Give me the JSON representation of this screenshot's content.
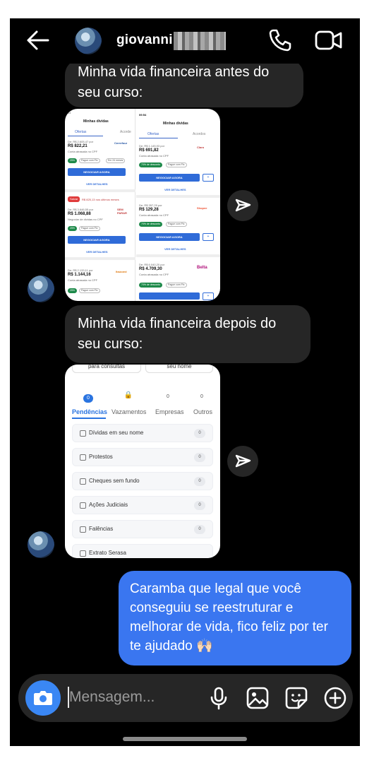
{
  "header": {
    "username": "giovanni"
  },
  "messages": [
    {
      "id": "m1",
      "from": "them",
      "text": "Minha vida financeira antes do seu curso:"
    },
    {
      "id": "m2",
      "from": "them",
      "text": "Minha vida financeira depois do seu curso:"
    },
    {
      "id": "m3",
      "from": "me",
      "text": "Caramba que legal que você conseguiu se reestruturar e melhorar de vida, fico feliz por ter te ajudado 🙌🏻"
    }
  ],
  "screenshot_before": {
    "left": {
      "status_time": "64",
      "title": "Minhas dívidas",
      "tabs": [
        "Ofertas",
        "Acorde"
      ],
      "items": [
        {
          "from": "De: R$ 2.605,47 por",
          "value": "R$ 822,21",
          "sub": "Conta atrasada no CPF",
          "brand": "Cerrefour",
          "button": "NEGOCIAR AGORA",
          "link": "VER DETALHES"
        },
        {
          "from": "De: R$ 3.646,55 por",
          "value": "R$ 1.068,88",
          "sub": "Negociar de dividas no CPF",
          "brand": "SEM PARAR",
          "button": "NEGOCIAR AGORA",
          "link": "VER DETALHES",
          "badge": "Salvar",
          "badge_note": "R$ 825,13 nos ultimos meses"
        },
        {
          "from": "De: R$ 2.133,11 por",
          "value": "R$ 1.144,16",
          "sub": "Conta atrasada no CPF",
          "brand": "Itaúcard"
        }
      ],
      "chips": [
        "25%",
        "Pague com Pix",
        "Em 24 meses"
      ]
    },
    "right": {
      "status_time": "09:54",
      "title": "Minhas dívidas",
      "tabs": [
        "Ofertas",
        "Acordos"
      ],
      "items": [
        {
          "from": "De: R$ 1.145,93 por",
          "value": "R$ 691,82",
          "sub": "Conta atrasada no CPF",
          "brand": "Claro",
          "button": "NEGOCIAR AGORA",
          "link": "VER DETALHES"
        },
        {
          "from": "De: R$ 357,29 por",
          "value": "R$ 129,28",
          "sub": "Conta atrasada no CPF",
          "brand": "Shopee",
          "button": "NEGOCIAR AGORA",
          "link": "VER DETALHES"
        },
        {
          "from": "De: R$ 6.040,20 por",
          "value": "R$ 4.709,30",
          "sub": "Conta atrasada no CPF",
          "brand": "Belta"
        }
      ],
      "chips": [
        "70% de desconto",
        "Pague com Pix"
      ]
    }
  },
  "screenshot_after": {
    "top_cards": [
      "para consultas",
      "seu nome"
    ],
    "tabs": [
      {
        "label": "Pendências",
        "count": "0",
        "active": true
      },
      {
        "label": "Vazamentos",
        "count": "🔒",
        "active": false
      },
      {
        "label": "Empresas",
        "count": "0",
        "active": false
      },
      {
        "label": "Outros",
        "count": "0",
        "active": false
      }
    ],
    "rows": [
      {
        "label": "Dívidas em seu nome",
        "count": "0"
      },
      {
        "label": "Protestos",
        "count": "0"
      },
      {
        "label": "Cheques sem fundo",
        "count": "0"
      },
      {
        "label": "Ações Judiciais",
        "count": "0"
      },
      {
        "label": "Falências",
        "count": "0"
      },
      {
        "label": "Extrato Serasa",
        "count": ""
      }
    ]
  },
  "composer": {
    "placeholder": "Mensagem..."
  },
  "icons": {
    "back": "back-arrow-icon",
    "call": "phone-icon",
    "video": "video-camera-icon",
    "share": "send-icon",
    "camera": "camera-icon",
    "mic": "microphone-icon",
    "gallery": "image-icon",
    "sticker": "sticker-icon",
    "add": "plus-circle-icon"
  },
  "colors": {
    "background": "#000000",
    "incoming_bubble": "#262626",
    "outgoing_bubble": "#3a76f0",
    "camera_button": "#3a87f4"
  }
}
